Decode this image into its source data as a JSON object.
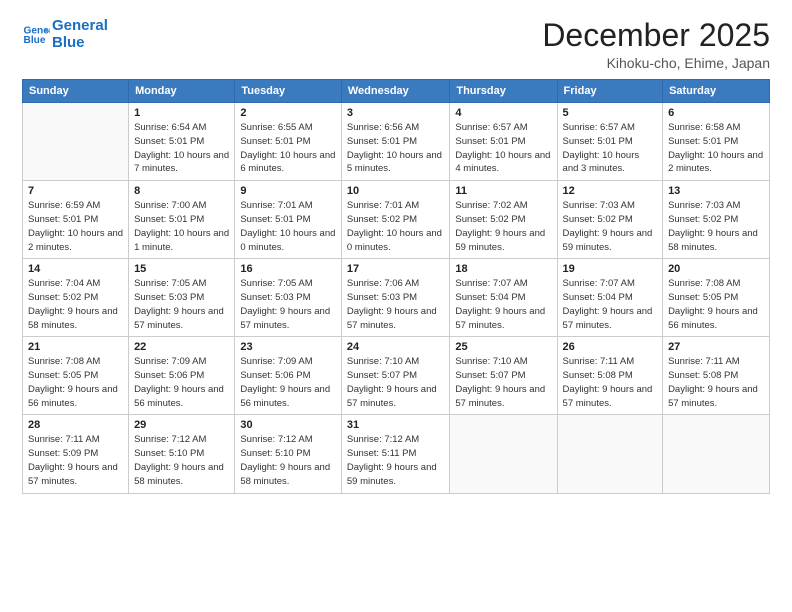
{
  "logo": {
    "line1": "General",
    "line2": "Blue"
  },
  "title": "December 2025",
  "location": "Kihoku-cho, Ehime, Japan",
  "weekdays": [
    "Sunday",
    "Monday",
    "Tuesday",
    "Wednesday",
    "Thursday",
    "Friday",
    "Saturday"
  ],
  "weeks": [
    [
      {
        "day": "",
        "sunrise": "",
        "sunset": "",
        "daylight": ""
      },
      {
        "day": "1",
        "sunrise": "Sunrise: 6:54 AM",
        "sunset": "Sunset: 5:01 PM",
        "daylight": "Daylight: 10 hours and 7 minutes."
      },
      {
        "day": "2",
        "sunrise": "Sunrise: 6:55 AM",
        "sunset": "Sunset: 5:01 PM",
        "daylight": "Daylight: 10 hours and 6 minutes."
      },
      {
        "day": "3",
        "sunrise": "Sunrise: 6:56 AM",
        "sunset": "Sunset: 5:01 PM",
        "daylight": "Daylight: 10 hours and 5 minutes."
      },
      {
        "day": "4",
        "sunrise": "Sunrise: 6:57 AM",
        "sunset": "Sunset: 5:01 PM",
        "daylight": "Daylight: 10 hours and 4 minutes."
      },
      {
        "day": "5",
        "sunrise": "Sunrise: 6:57 AM",
        "sunset": "Sunset: 5:01 PM",
        "daylight": "Daylight: 10 hours and 3 minutes."
      },
      {
        "day": "6",
        "sunrise": "Sunrise: 6:58 AM",
        "sunset": "Sunset: 5:01 PM",
        "daylight": "Daylight: 10 hours and 2 minutes."
      }
    ],
    [
      {
        "day": "7",
        "sunrise": "Sunrise: 6:59 AM",
        "sunset": "Sunset: 5:01 PM",
        "daylight": "Daylight: 10 hours and 2 minutes."
      },
      {
        "day": "8",
        "sunrise": "Sunrise: 7:00 AM",
        "sunset": "Sunset: 5:01 PM",
        "daylight": "Daylight: 10 hours and 1 minute."
      },
      {
        "day": "9",
        "sunrise": "Sunrise: 7:01 AM",
        "sunset": "Sunset: 5:01 PM",
        "daylight": "Daylight: 10 hours and 0 minutes."
      },
      {
        "day": "10",
        "sunrise": "Sunrise: 7:01 AM",
        "sunset": "Sunset: 5:02 PM",
        "daylight": "Daylight: 10 hours and 0 minutes."
      },
      {
        "day": "11",
        "sunrise": "Sunrise: 7:02 AM",
        "sunset": "Sunset: 5:02 PM",
        "daylight": "Daylight: 9 hours and 59 minutes."
      },
      {
        "day": "12",
        "sunrise": "Sunrise: 7:03 AM",
        "sunset": "Sunset: 5:02 PM",
        "daylight": "Daylight: 9 hours and 59 minutes."
      },
      {
        "day": "13",
        "sunrise": "Sunrise: 7:03 AM",
        "sunset": "Sunset: 5:02 PM",
        "daylight": "Daylight: 9 hours and 58 minutes."
      }
    ],
    [
      {
        "day": "14",
        "sunrise": "Sunrise: 7:04 AM",
        "sunset": "Sunset: 5:02 PM",
        "daylight": "Daylight: 9 hours and 58 minutes."
      },
      {
        "day": "15",
        "sunrise": "Sunrise: 7:05 AM",
        "sunset": "Sunset: 5:03 PM",
        "daylight": "Daylight: 9 hours and 57 minutes."
      },
      {
        "day": "16",
        "sunrise": "Sunrise: 7:05 AM",
        "sunset": "Sunset: 5:03 PM",
        "daylight": "Daylight: 9 hours and 57 minutes."
      },
      {
        "day": "17",
        "sunrise": "Sunrise: 7:06 AM",
        "sunset": "Sunset: 5:03 PM",
        "daylight": "Daylight: 9 hours and 57 minutes."
      },
      {
        "day": "18",
        "sunrise": "Sunrise: 7:07 AM",
        "sunset": "Sunset: 5:04 PM",
        "daylight": "Daylight: 9 hours and 57 minutes."
      },
      {
        "day": "19",
        "sunrise": "Sunrise: 7:07 AM",
        "sunset": "Sunset: 5:04 PM",
        "daylight": "Daylight: 9 hours and 57 minutes."
      },
      {
        "day": "20",
        "sunrise": "Sunrise: 7:08 AM",
        "sunset": "Sunset: 5:05 PM",
        "daylight": "Daylight: 9 hours and 56 minutes."
      }
    ],
    [
      {
        "day": "21",
        "sunrise": "Sunrise: 7:08 AM",
        "sunset": "Sunset: 5:05 PM",
        "daylight": "Daylight: 9 hours and 56 minutes."
      },
      {
        "day": "22",
        "sunrise": "Sunrise: 7:09 AM",
        "sunset": "Sunset: 5:06 PM",
        "daylight": "Daylight: 9 hours and 56 minutes."
      },
      {
        "day": "23",
        "sunrise": "Sunrise: 7:09 AM",
        "sunset": "Sunset: 5:06 PM",
        "daylight": "Daylight: 9 hours and 56 minutes."
      },
      {
        "day": "24",
        "sunrise": "Sunrise: 7:10 AM",
        "sunset": "Sunset: 5:07 PM",
        "daylight": "Daylight: 9 hours and 57 minutes."
      },
      {
        "day": "25",
        "sunrise": "Sunrise: 7:10 AM",
        "sunset": "Sunset: 5:07 PM",
        "daylight": "Daylight: 9 hours and 57 minutes."
      },
      {
        "day": "26",
        "sunrise": "Sunrise: 7:11 AM",
        "sunset": "Sunset: 5:08 PM",
        "daylight": "Daylight: 9 hours and 57 minutes."
      },
      {
        "day": "27",
        "sunrise": "Sunrise: 7:11 AM",
        "sunset": "Sunset: 5:08 PM",
        "daylight": "Daylight: 9 hours and 57 minutes."
      }
    ],
    [
      {
        "day": "28",
        "sunrise": "Sunrise: 7:11 AM",
        "sunset": "Sunset: 5:09 PM",
        "daylight": "Daylight: 9 hours and 57 minutes."
      },
      {
        "day": "29",
        "sunrise": "Sunrise: 7:12 AM",
        "sunset": "Sunset: 5:10 PM",
        "daylight": "Daylight: 9 hours and 58 minutes."
      },
      {
        "day": "30",
        "sunrise": "Sunrise: 7:12 AM",
        "sunset": "Sunset: 5:10 PM",
        "daylight": "Daylight: 9 hours and 58 minutes."
      },
      {
        "day": "31",
        "sunrise": "Sunrise: 7:12 AM",
        "sunset": "Sunset: 5:11 PM",
        "daylight": "Daylight: 9 hours and 59 minutes."
      },
      {
        "day": "",
        "sunrise": "",
        "sunset": "",
        "daylight": ""
      },
      {
        "day": "",
        "sunrise": "",
        "sunset": "",
        "daylight": ""
      },
      {
        "day": "",
        "sunrise": "",
        "sunset": "",
        "daylight": ""
      }
    ]
  ]
}
